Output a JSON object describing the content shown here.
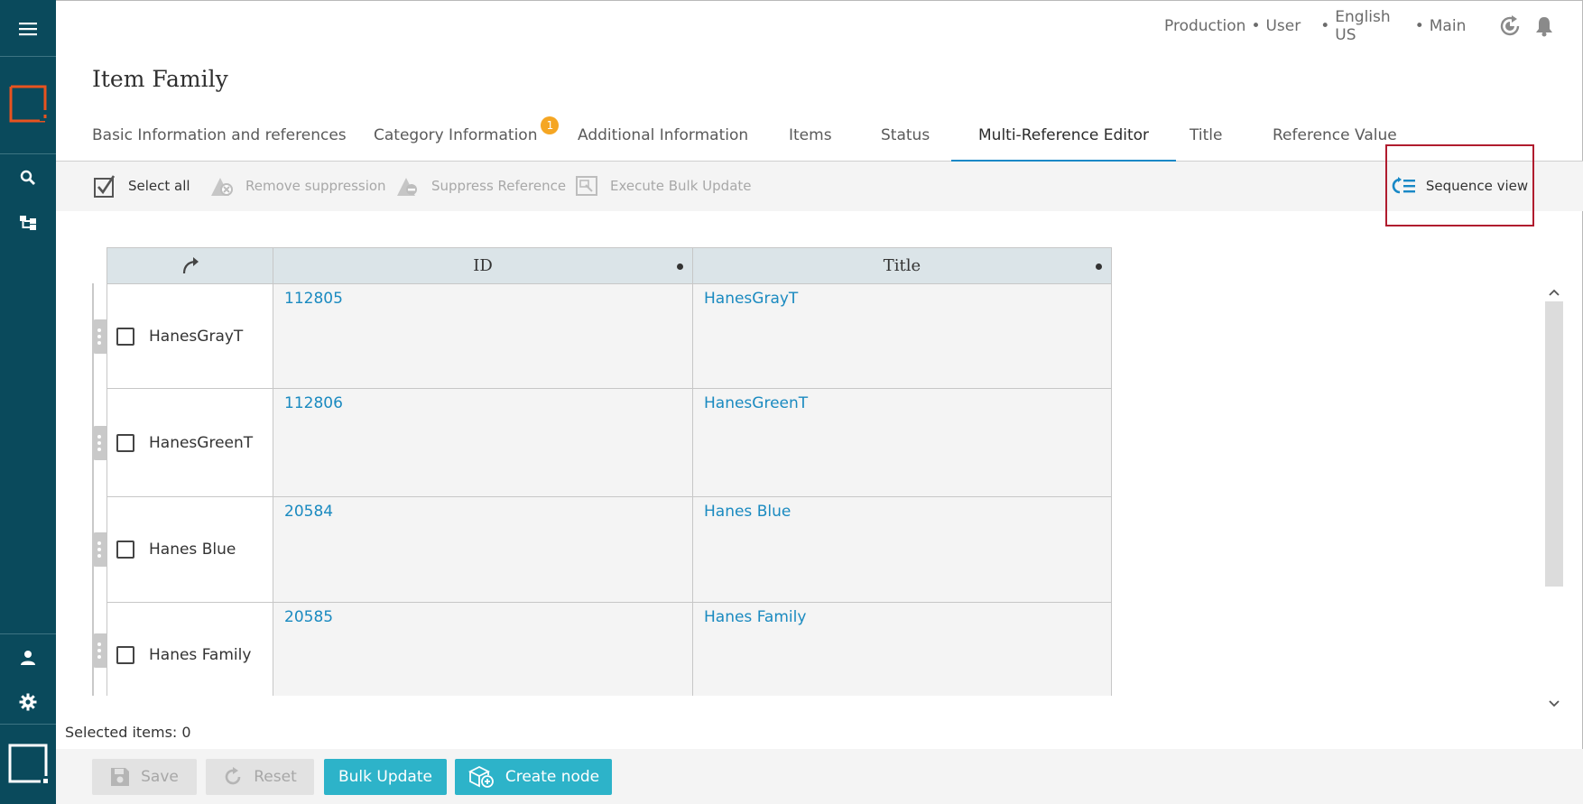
{
  "header": {
    "context": {
      "environment": "Production",
      "role": "User",
      "locale": "English US",
      "workspace": "Main"
    },
    "separator": "•"
  },
  "page": {
    "title": "Item Family"
  },
  "tabs": [
    {
      "label": "Basic Information and references"
    },
    {
      "label": "Category Information",
      "badge": "1"
    },
    {
      "label": "Additional Information"
    },
    {
      "label": "Items"
    },
    {
      "label": "Status"
    },
    {
      "label": "Multi-Reference Editor",
      "active": true
    },
    {
      "label": "Title"
    },
    {
      "label": "Reference Value"
    }
  ],
  "toolbar": {
    "select_all": "Select all",
    "remove_suppression": "Remove suppression",
    "suppress_reference": "Suppress Reference",
    "execute_bulk_update": "Execute Bulk Update",
    "sequence_view": "Sequence view"
  },
  "grid": {
    "columns": [
      "ID",
      "Title"
    ],
    "rows": [
      {
        "name": "HanesGrayT",
        "id": "112805",
        "title": "HanesGrayT"
      },
      {
        "name": "HanesGreenT",
        "id": "112806",
        "title": "HanesGreenT"
      },
      {
        "name": "Hanes Blue",
        "id": "20584",
        "title": "Hanes Blue"
      },
      {
        "name": "Hanes Family",
        "id": "20585",
        "title": "Hanes Family"
      }
    ]
  },
  "footer": {
    "selected_label": "Selected items: 0",
    "save": "Save",
    "reset": "Reset",
    "bulk_update": "Bulk Update",
    "create_node": "Create node"
  },
  "colors": {
    "sidebar": "#0a4a5c",
    "accent": "#1888c6",
    "primary_button": "#2db3c9",
    "link": "#1a8ac0",
    "badge": "#f5a623",
    "highlight_box": "#b01c2e",
    "logo": "#e8531f"
  },
  "icons": {
    "sidebar": [
      "hamburger-menu-icon",
      "app-logo-icon",
      "search-icon",
      "hierarchy-icon",
      "user-icon",
      "gear-icon",
      "workspace-icon"
    ],
    "top": [
      "history-icon",
      "bell-icon"
    ]
  }
}
